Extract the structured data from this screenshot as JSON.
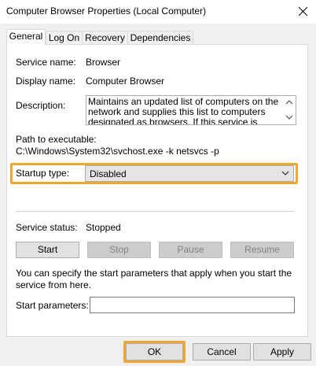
{
  "window": {
    "title": "Computer Browser Properties (Local Computer)"
  },
  "tabs": [
    {
      "label": "General",
      "active": true
    },
    {
      "label": "Log On",
      "active": false
    },
    {
      "label": "Recovery",
      "active": false
    },
    {
      "label": "Dependencies",
      "active": false
    }
  ],
  "general": {
    "service_name_label": "Service name:",
    "service_name_value": "Browser",
    "display_name_label": "Display name:",
    "display_name_value": "Computer Browser",
    "description_label": "Description:",
    "description_value": "Maintains an updated list of computers on the network and supplies this list to computers designated as browsers. If this service is stopped",
    "path_label": "Path to executable:",
    "path_value": "C:\\Windows\\System32\\svchost.exe -k netsvcs -p",
    "startup_type_label": "Startup type:",
    "startup_type_value": "Disabled",
    "service_status_label": "Service status:",
    "service_status_value": "Stopped",
    "buttons": {
      "start": "Start",
      "stop": "Stop",
      "pause": "Pause",
      "resume": "Resume"
    },
    "start_params_hint": "You can specify the start parameters that apply when you start the service from here.",
    "start_params_label": "Start parameters:",
    "start_params_value": ""
  },
  "dialog_buttons": {
    "ok": "OK",
    "cancel": "Cancel",
    "apply": "Apply"
  },
  "colors": {
    "highlight": "#f0a732",
    "panel_bg": "#ffffff",
    "window_bg": "#f0f0f0"
  }
}
